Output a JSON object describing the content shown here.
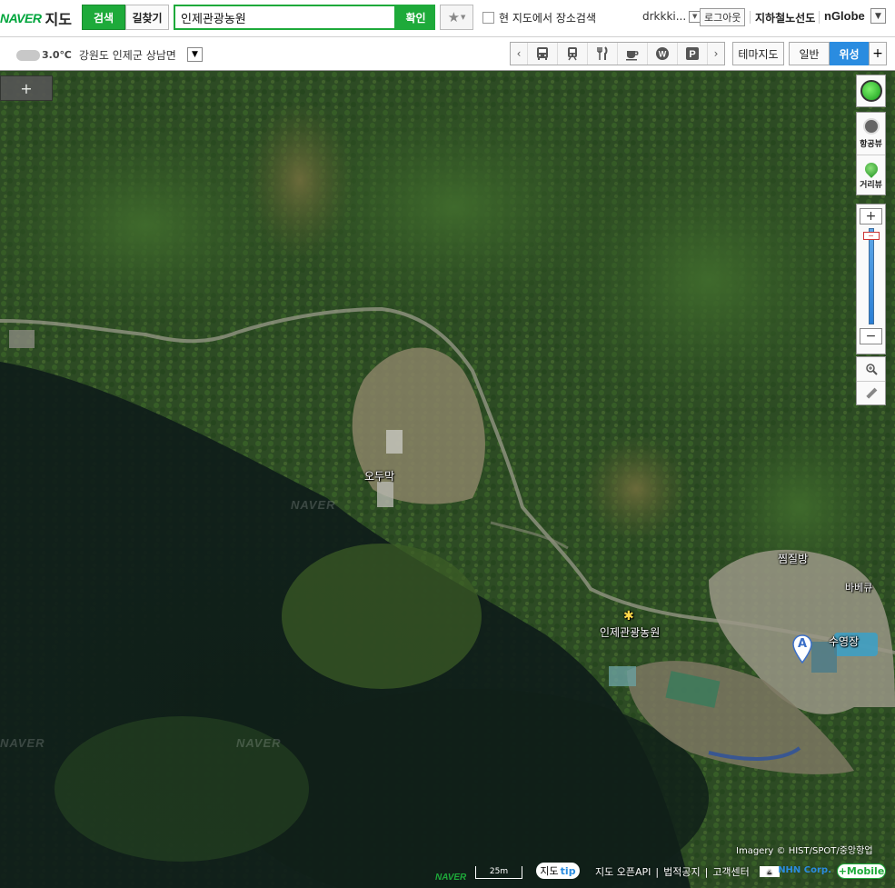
{
  "header": {
    "logo_brand": "NAVER",
    "logo_service": "지도",
    "tab_search": "검색",
    "tab_route": "길찾기",
    "search_value": "인제관광농원",
    "confirm": "확인",
    "area_search_label": "현 지도에서 장소검색",
    "user": "drkkki...",
    "logout": "로그아웃",
    "subway": "지하철노선도",
    "nglobe": "nGlobe"
  },
  "subbar": {
    "temperature": "3.0",
    "temp_unit": "℃",
    "address": "강원도 인제군 상남면",
    "categories": [
      "bus-icon",
      "subway-icon",
      "restaurant-icon",
      "cafe-icon",
      "bank-icon",
      "parking-icon"
    ],
    "theme_map": "테마지도",
    "mode_general": "일반",
    "mode_satellite": "위성"
  },
  "controls": {
    "aerial_view": "항공뷰",
    "street_view": "거리뷰"
  },
  "map": {
    "labels": {
      "odumak": "오두막",
      "main_place": "인제관광농원",
      "sauna": "찜질방",
      "bbq": "바베큐",
      "pool": "수영장"
    },
    "marker_letter": "A",
    "watermark": "NAVER",
    "attribution": "Imagery © HIST/SPOT/중앙항업",
    "scale": "25m"
  },
  "footer": {
    "tip_prefix": "지도",
    "tip_suffix": "tip",
    "open_api": "지도 오픈API",
    "legal": "법적공지",
    "customer_center": "고객센터",
    "copyright_prefix": "©",
    "copyright_company": "NHN Corp.",
    "mobile": "+Mobile"
  },
  "colors": {
    "naver_green": "#1eaa3a",
    "satellite_blue": "#2a8ce0",
    "forest_dark": "#1c3220"
  }
}
